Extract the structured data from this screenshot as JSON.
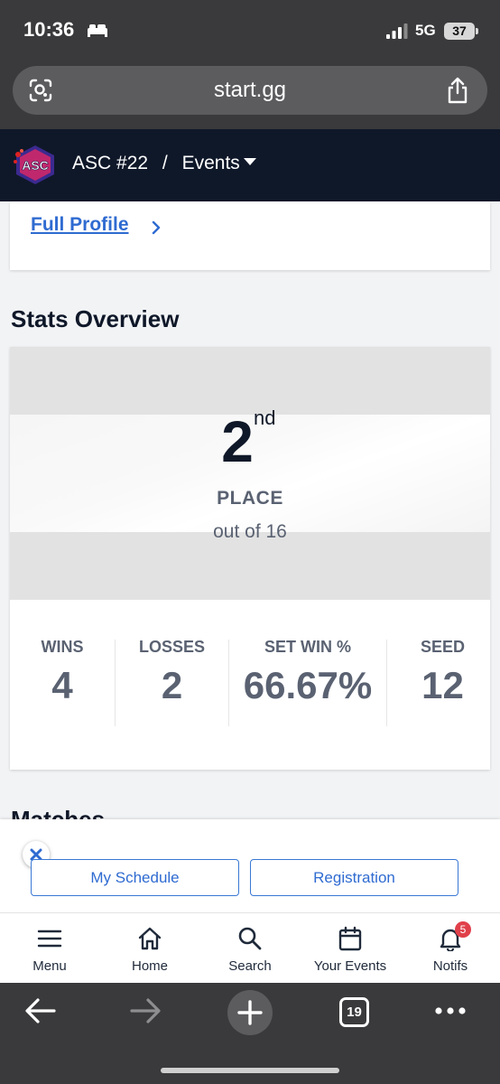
{
  "status_bar": {
    "time": "10:36",
    "network": "5G",
    "battery": "37"
  },
  "browser": {
    "url": "start.gg",
    "tab_count": "19"
  },
  "header": {
    "tournament": "ASC #22",
    "separator": "/",
    "section": "Events"
  },
  "profile": {
    "full_profile_link": "Full Profile"
  },
  "stats": {
    "title": "Stats Overview",
    "placement": {
      "number": "2",
      "suffix": "nd",
      "label": "PLACE",
      "out_of": "out of 16"
    },
    "items": [
      {
        "label": "WINS",
        "value": "4"
      },
      {
        "label": "LOSSES",
        "value": "2"
      },
      {
        "label": "SET WIN %",
        "value": "66.67%"
      },
      {
        "label": "SEED",
        "value": "12"
      }
    ]
  },
  "matches": {
    "title": "Matches"
  },
  "actions": {
    "my_schedule": "My Schedule",
    "registration": "Registration"
  },
  "bottom_nav": {
    "items": [
      {
        "label": "Menu",
        "icon": "menu-icon"
      },
      {
        "label": "Home",
        "icon": "home-icon"
      },
      {
        "label": "Search",
        "icon": "search-icon"
      },
      {
        "label": "Your Events",
        "icon": "calendar-icon"
      },
      {
        "label": "Notifs",
        "icon": "bell-icon",
        "badge": "5"
      }
    ]
  },
  "colors": {
    "header_bg": "#0f1829",
    "link": "#2f6bd1",
    "badge": "#e0404a",
    "stat_text": "#5a6272"
  }
}
